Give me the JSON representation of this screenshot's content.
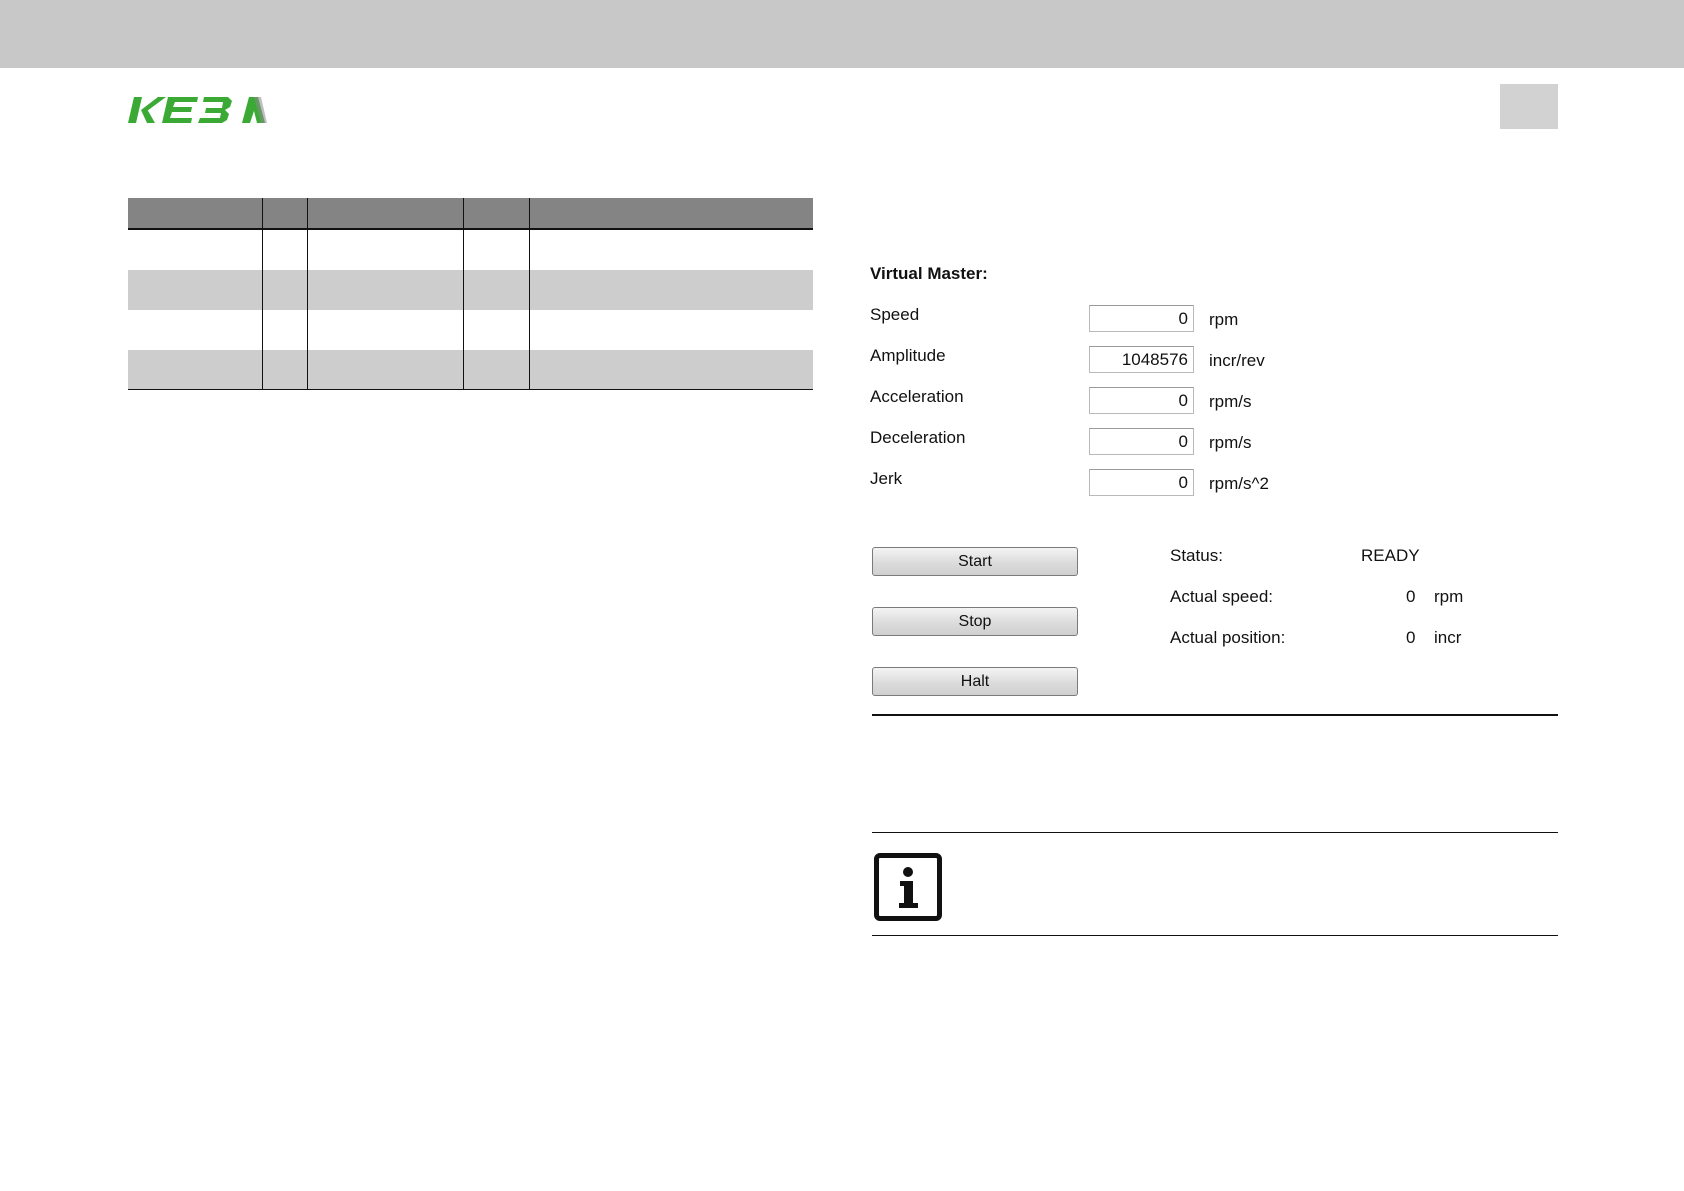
{
  "header": {
    "logo_text": "KEBA",
    "brand_color": "#3aaa35",
    "logo_gray": "#8a8a8a"
  },
  "table": {
    "columns": 5,
    "rows": 4,
    "header_color": "#848484",
    "stripe_color": "#cdcdcd"
  },
  "virtual_master": {
    "title": "Virtual Master:",
    "params": [
      {
        "label": "Speed",
        "value": "0",
        "unit": "rpm"
      },
      {
        "label": "Amplitude",
        "value": "1048576",
        "unit": "incr/rev"
      },
      {
        "label": "Acceleration",
        "value": "0",
        "unit": "rpm/s"
      },
      {
        "label": "Deceleration",
        "value": "0",
        "unit": "rpm/s"
      },
      {
        "label": "Jerk",
        "value": "0",
        "unit": "rpm/s^2"
      }
    ],
    "buttons": {
      "start": "Start",
      "stop": "Stop",
      "halt": "Halt"
    },
    "status": {
      "status_label": "Status:",
      "status_value": "READY",
      "speed_label": "Actual speed:",
      "speed_value": "0",
      "speed_unit": "rpm",
      "position_label": "Actual position:",
      "position_value": "0",
      "position_unit": "incr"
    }
  },
  "info": {
    "icon": "info-icon"
  }
}
